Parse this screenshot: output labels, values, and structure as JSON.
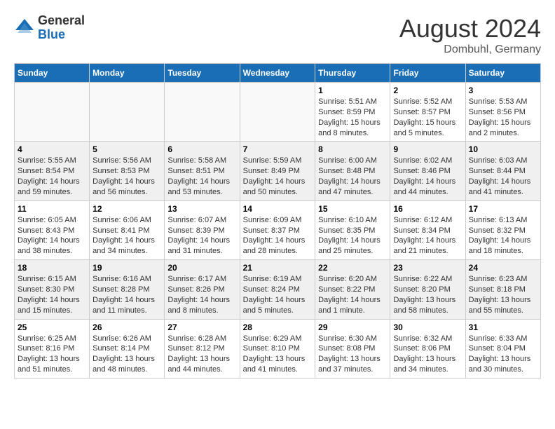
{
  "header": {
    "logo_general": "General",
    "logo_blue": "Blue",
    "month_year": "August 2024",
    "location": "Dombuhl, Germany"
  },
  "weekdays": [
    "Sunday",
    "Monday",
    "Tuesday",
    "Wednesday",
    "Thursday",
    "Friday",
    "Saturday"
  ],
  "weeks": [
    [
      {
        "day": "",
        "info": ""
      },
      {
        "day": "",
        "info": ""
      },
      {
        "day": "",
        "info": ""
      },
      {
        "day": "",
        "info": ""
      },
      {
        "day": "1",
        "info": "Sunrise: 5:51 AM\nSunset: 8:59 PM\nDaylight: 15 hours\nand 8 minutes."
      },
      {
        "day": "2",
        "info": "Sunrise: 5:52 AM\nSunset: 8:57 PM\nDaylight: 15 hours\nand 5 minutes."
      },
      {
        "day": "3",
        "info": "Sunrise: 5:53 AM\nSunset: 8:56 PM\nDaylight: 15 hours\nand 2 minutes."
      }
    ],
    [
      {
        "day": "4",
        "info": "Sunrise: 5:55 AM\nSunset: 8:54 PM\nDaylight: 14 hours\nand 59 minutes."
      },
      {
        "day": "5",
        "info": "Sunrise: 5:56 AM\nSunset: 8:53 PM\nDaylight: 14 hours\nand 56 minutes."
      },
      {
        "day": "6",
        "info": "Sunrise: 5:58 AM\nSunset: 8:51 PM\nDaylight: 14 hours\nand 53 minutes."
      },
      {
        "day": "7",
        "info": "Sunrise: 5:59 AM\nSunset: 8:49 PM\nDaylight: 14 hours\nand 50 minutes."
      },
      {
        "day": "8",
        "info": "Sunrise: 6:00 AM\nSunset: 8:48 PM\nDaylight: 14 hours\nand 47 minutes."
      },
      {
        "day": "9",
        "info": "Sunrise: 6:02 AM\nSunset: 8:46 PM\nDaylight: 14 hours\nand 44 minutes."
      },
      {
        "day": "10",
        "info": "Sunrise: 6:03 AM\nSunset: 8:44 PM\nDaylight: 14 hours\nand 41 minutes."
      }
    ],
    [
      {
        "day": "11",
        "info": "Sunrise: 6:05 AM\nSunset: 8:43 PM\nDaylight: 14 hours\nand 38 minutes."
      },
      {
        "day": "12",
        "info": "Sunrise: 6:06 AM\nSunset: 8:41 PM\nDaylight: 14 hours\nand 34 minutes."
      },
      {
        "day": "13",
        "info": "Sunrise: 6:07 AM\nSunset: 8:39 PM\nDaylight: 14 hours\nand 31 minutes."
      },
      {
        "day": "14",
        "info": "Sunrise: 6:09 AM\nSunset: 8:37 PM\nDaylight: 14 hours\nand 28 minutes."
      },
      {
        "day": "15",
        "info": "Sunrise: 6:10 AM\nSunset: 8:35 PM\nDaylight: 14 hours\nand 25 minutes."
      },
      {
        "day": "16",
        "info": "Sunrise: 6:12 AM\nSunset: 8:34 PM\nDaylight: 14 hours\nand 21 minutes."
      },
      {
        "day": "17",
        "info": "Sunrise: 6:13 AM\nSunset: 8:32 PM\nDaylight: 14 hours\nand 18 minutes."
      }
    ],
    [
      {
        "day": "18",
        "info": "Sunrise: 6:15 AM\nSunset: 8:30 PM\nDaylight: 14 hours\nand 15 minutes."
      },
      {
        "day": "19",
        "info": "Sunrise: 6:16 AM\nSunset: 8:28 PM\nDaylight: 14 hours\nand 11 minutes."
      },
      {
        "day": "20",
        "info": "Sunrise: 6:17 AM\nSunset: 8:26 PM\nDaylight: 14 hours\nand 8 minutes."
      },
      {
        "day": "21",
        "info": "Sunrise: 6:19 AM\nSunset: 8:24 PM\nDaylight: 14 hours\nand 5 minutes."
      },
      {
        "day": "22",
        "info": "Sunrise: 6:20 AM\nSunset: 8:22 PM\nDaylight: 14 hours\nand 1 minute."
      },
      {
        "day": "23",
        "info": "Sunrise: 6:22 AM\nSunset: 8:20 PM\nDaylight: 13 hours\nand 58 minutes."
      },
      {
        "day": "24",
        "info": "Sunrise: 6:23 AM\nSunset: 8:18 PM\nDaylight: 13 hours\nand 55 minutes."
      }
    ],
    [
      {
        "day": "25",
        "info": "Sunrise: 6:25 AM\nSunset: 8:16 PM\nDaylight: 13 hours\nand 51 minutes."
      },
      {
        "day": "26",
        "info": "Sunrise: 6:26 AM\nSunset: 8:14 PM\nDaylight: 13 hours\nand 48 minutes."
      },
      {
        "day": "27",
        "info": "Sunrise: 6:28 AM\nSunset: 8:12 PM\nDaylight: 13 hours\nand 44 minutes."
      },
      {
        "day": "28",
        "info": "Sunrise: 6:29 AM\nSunset: 8:10 PM\nDaylight: 13 hours\nand 41 minutes."
      },
      {
        "day": "29",
        "info": "Sunrise: 6:30 AM\nSunset: 8:08 PM\nDaylight: 13 hours\nand 37 minutes."
      },
      {
        "day": "30",
        "info": "Sunrise: 6:32 AM\nSunset: 8:06 PM\nDaylight: 13 hours\nand 34 minutes."
      },
      {
        "day": "31",
        "info": "Sunrise: 6:33 AM\nSunset: 8:04 PM\nDaylight: 13 hours\nand 30 minutes."
      }
    ]
  ]
}
